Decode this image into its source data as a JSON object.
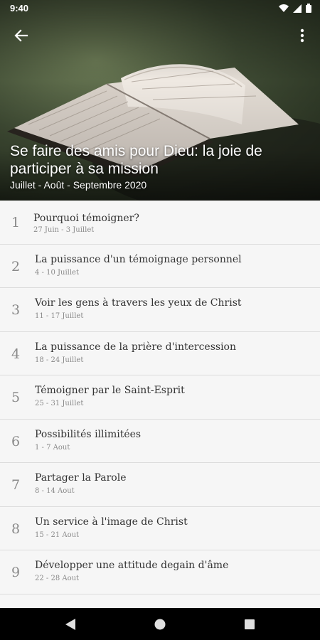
{
  "status_bar": {
    "time": "9:40"
  },
  "header": {
    "title": "Se faire des amis pour Dieu: la joie de participer à sa mission",
    "subtitle": "Juillet - Août - Septembre 2020"
  },
  "lessons": [
    {
      "number": "1",
      "title": "Pourquoi témoigner?",
      "date": "27 Juin - 3 Juillet"
    },
    {
      "number": "2",
      "title": "La puissance d'un témoignage personnel",
      "date": "4 - 10 Juillet"
    },
    {
      "number": "3",
      "title": "Voir les gens à travers les yeux de Christ",
      "date": "11 - 17 Juillet"
    },
    {
      "number": "4",
      "title": "La puissance de la prière d'intercession",
      "date": "18 - 24 Juillet"
    },
    {
      "number": "5",
      "title": "Témoigner par le Saint-Esprit",
      "date": "25 - 31 Juillet"
    },
    {
      "number": "6",
      "title": "Possibilités illimitées",
      "date": "1 - 7 Aout"
    },
    {
      "number": "7",
      "title": "Partager la Parole",
      "date": "8 - 14 Aout"
    },
    {
      "number": "8",
      "title": "Un service à l'image de Christ",
      "date": "15 - 21 Aout"
    },
    {
      "number": "9",
      "title": "Développer une attitude degain d'âme",
      "date": "22 - 28 Aout"
    }
  ]
}
